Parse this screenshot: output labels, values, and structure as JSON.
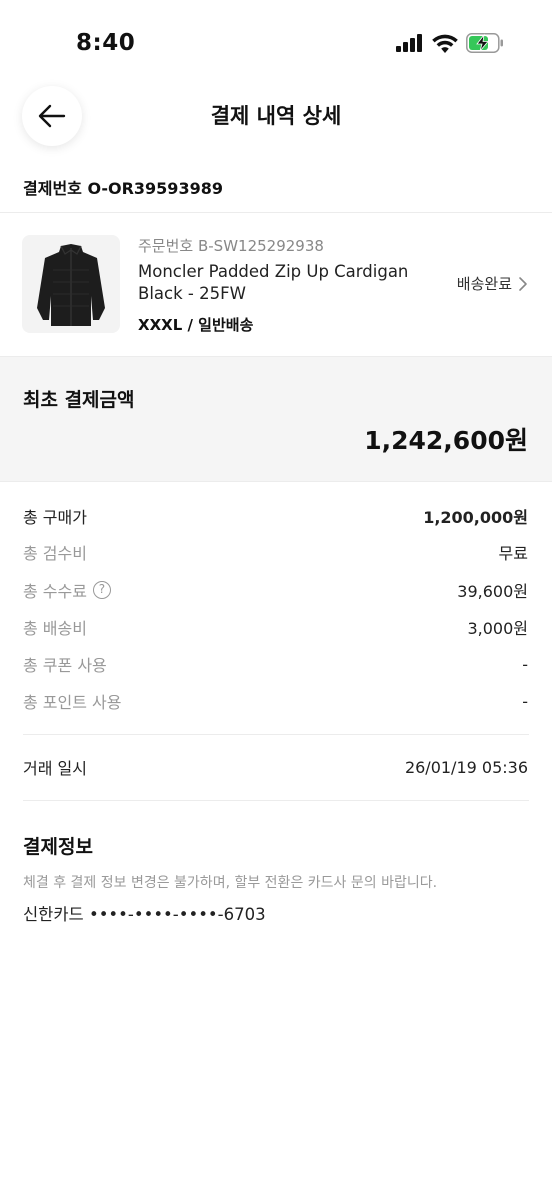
{
  "status": {
    "time": "8:40",
    "icons": [
      "signal-icon",
      "wifi-icon",
      "battery-charging-icon"
    ]
  },
  "header": {
    "title": "결제 내역 상세",
    "back_icon": "arrow-left-icon"
  },
  "payment_number": "결제번호 O-OR39593989",
  "product": {
    "order_no": "주문번호 B-SW125292938",
    "name": "Moncler Padded Zip Up Cardigan Black - 25FW",
    "option": "XXXL / 일반배송",
    "status": "배송완료",
    "image": "black-padded-cardigan-thumbnail"
  },
  "total": {
    "label": "최초 결제금액",
    "amount": "1,242,600원"
  },
  "breakdown": [
    {
      "label": "총 구매가",
      "value": "1,200,000원"
    },
    {
      "label": "총 검수비",
      "value": "무료"
    },
    {
      "label": "총 수수료",
      "value": "39,600원"
    },
    {
      "label": "총 배송비",
      "value": "3,000원"
    },
    {
      "label": "총 쿠폰 사용",
      "value": "-"
    },
    {
      "label": "총 포인트 사용",
      "value": "-"
    }
  ],
  "transaction": {
    "label": "거래 일시",
    "value": "26/01/19 05:36"
  },
  "payment_info": {
    "title": "결제정보",
    "note": "체결 후 결제 정보 변경은 불가하며, 할부 전환은 카드사 문의 바랍니다.",
    "card": "신한카드 ••••-••••-••••-6703"
  },
  "colors": {
    "accent_text": "#111111",
    "muted_text": "#999999",
    "battery_green": "#35c759",
    "section_bg": "#f5f5f5"
  }
}
